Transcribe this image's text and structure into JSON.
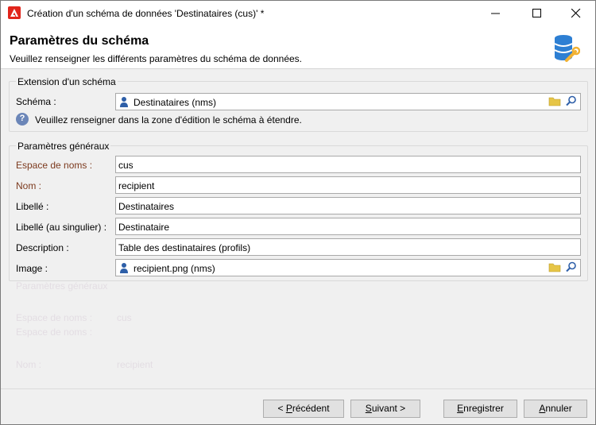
{
  "window": {
    "title": "Création d'un schéma de données 'Destinataires (cus)' *"
  },
  "header": {
    "title": "Paramètres du schéma",
    "subtitle": "Veuillez renseigner les différents paramètres du schéma de données."
  },
  "extension_group": {
    "legend": "Extension d'un schéma",
    "schema_label": "Schéma :",
    "schema_value": "Destinataires (nms)",
    "hint": "Veuillez renseigner dans la zone d'édition le schéma à étendre."
  },
  "general_group": {
    "legend": "Paramètres généraux",
    "fields": {
      "namespace_label": "Espace de noms :",
      "namespace_value": "cus",
      "name_label": "Nom :",
      "name_value": "recipient",
      "label_label": "Libellé :",
      "label_value": "Destinataires",
      "singular_label": "Libellé (au singulier) :",
      "singular_value": "Destinataire",
      "description_label": "Description :",
      "description_value": "Table des destinataires (profils)",
      "image_label": "Image :",
      "image_value": "recipient.png (nms)"
    }
  },
  "footer": {
    "previous_prefix": "< ",
    "previous_hotkey": "P",
    "previous_rest": "récédent",
    "next_hotkey": "S",
    "next_rest": "uivant >",
    "save_hotkey": "E",
    "save_rest": "nregistrer",
    "cancel_hotkey": "A",
    "cancel_rest": "nnuler"
  },
  "colors": {
    "required_label": "#7c3a1e",
    "app_icon": "#e1251b",
    "folder_icon": "#e6c547",
    "hint_icon": "#6b86b8"
  }
}
